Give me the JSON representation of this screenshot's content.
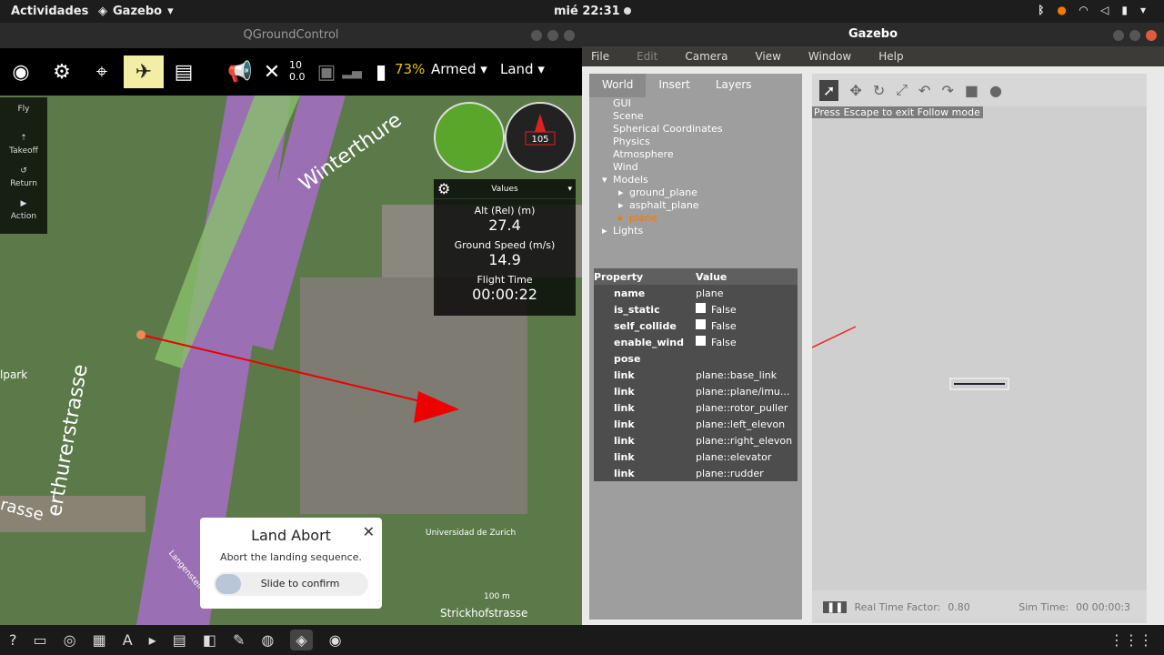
{
  "topbar": {
    "activities": "Actividades",
    "app": "Gazebo",
    "clock": "mié 22:31"
  },
  "qgc": {
    "title": "QGroundControl",
    "battery": "73%",
    "sat_count": "10",
    "hdop": "0.0",
    "armed": "Armed",
    "mode": "Land",
    "rail": [
      "Fly",
      "Takeoff",
      "Return",
      "Action"
    ],
    "values": {
      "header": "Values",
      "alt_label": "Alt (Rel) (m)",
      "alt": "27.4",
      "gs_label": "Ground Speed (m/s)",
      "gs": "14.9",
      "ft_label": "Flight Time",
      "ft": "00:00:22"
    },
    "compass": "105",
    "land": {
      "title": "Land Abort",
      "desc": "Abort the landing sequence.",
      "slider": "Slide to confirm"
    },
    "map_labels": {
      "winterthure": "Winterthure",
      "road": "erthurerstrasse",
      "park": "lpark",
      "rasse": "rasse",
      "uni": "Universidad de Zurich",
      "scale": "100 m",
      "strick": "Strickhofstrasse",
      "langen": "Langensteine"
    }
  },
  "gazebo": {
    "title": "Gazebo",
    "menu": [
      "File",
      "Edit",
      "Camera",
      "View",
      "Window",
      "Help"
    ],
    "tabs": [
      "World",
      "Insert",
      "Layers"
    ],
    "tree": [
      "GUI",
      "Scene",
      "Spherical Coordinates",
      "Physics",
      "Atmosphere",
      "Wind",
      "Models",
      "ground_plane",
      "asphalt_plane",
      "plane",
      "Lights"
    ],
    "prop_header": {
      "k": "Property",
      "v": "Value"
    },
    "props": [
      {
        "k": "name",
        "v": "plane"
      },
      {
        "k": "is_static",
        "v": "False"
      },
      {
        "k": "self_collide",
        "v": "False"
      },
      {
        "k": "enable_wind",
        "v": "False"
      },
      {
        "k": "pose",
        "v": ""
      },
      {
        "k": "link",
        "v": "plane::base_link"
      },
      {
        "k": "link",
        "v": "plane::plane/imu..."
      },
      {
        "k": "link",
        "v": "plane::rotor_puller"
      },
      {
        "k": "link",
        "v": "plane::left_elevon"
      },
      {
        "k": "link",
        "v": "plane::right_elevon"
      },
      {
        "k": "link",
        "v": "plane::elevator"
      },
      {
        "k": "link",
        "v": "plane::rudder"
      }
    ],
    "hint": "Press Escape to exit Follow mode",
    "rtf_label": "Real Time Factor:",
    "rtf": "0.80",
    "sim_label": "Sim Time:",
    "sim": "00 00:00:3"
  }
}
